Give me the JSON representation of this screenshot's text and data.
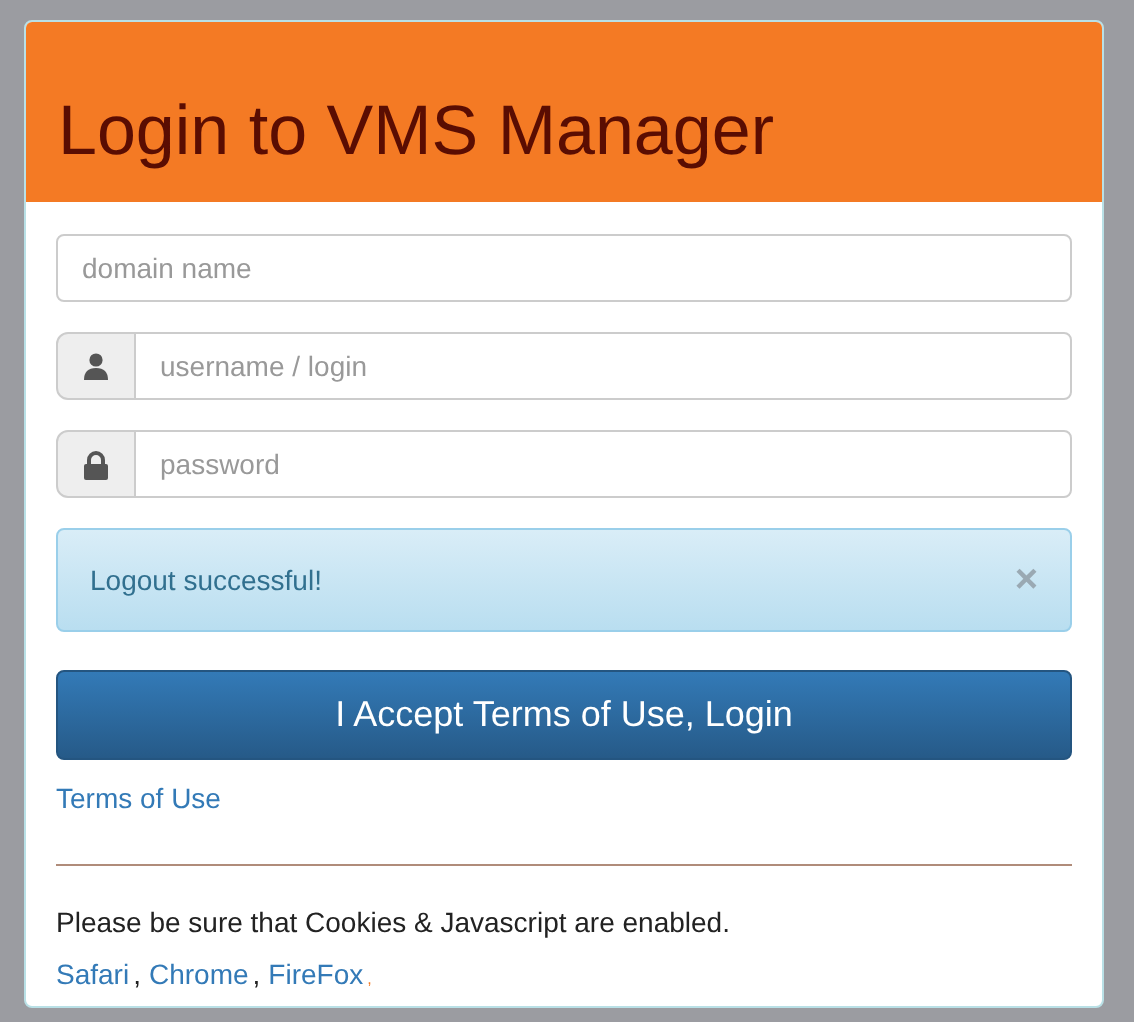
{
  "title": "Login to VMS Manager",
  "fields": [
    {
      "kind": "plain",
      "placeholder": "domain name"
    },
    {
      "kind": "user",
      "placeholder": "username / login"
    },
    {
      "kind": "lock",
      "placeholder": "password"
    }
  ],
  "alert": {
    "message": "Logout successful!",
    "close": "×"
  },
  "login_button": "I Accept Terms of Use, Login",
  "terms_link": "Terms of Use",
  "notice": "Please be sure that Cookies & Javascript are enabled.",
  "browsers": [
    {
      "name": "Safari",
      "separator": ","
    },
    {
      "name": "Chrome",
      "separator": ","
    },
    {
      "name": "FireFox",
      "separator": ","
    }
  ]
}
